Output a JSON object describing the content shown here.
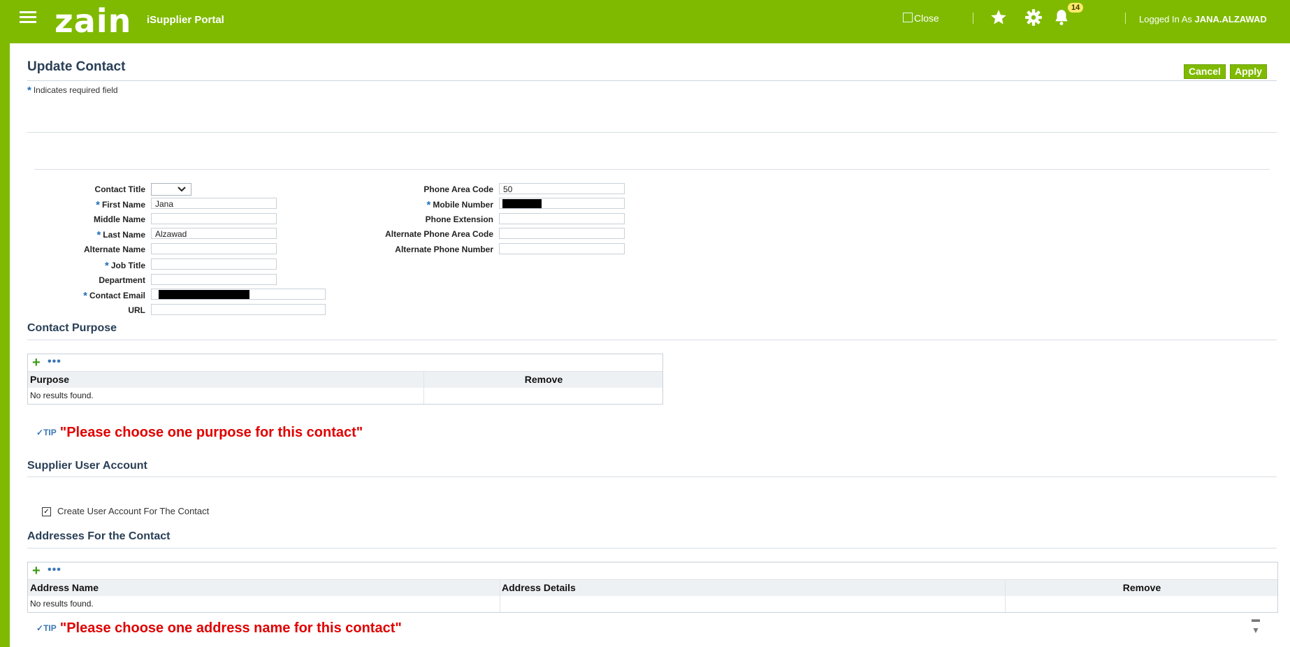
{
  "header": {
    "logo_text": "zain",
    "portal_title": "iSupplier Portal",
    "close_label": "Close",
    "notification_count": "14",
    "logged_in_prefix": "Logged In As",
    "username": "JANA.ALZAWAD",
    "brand_color": "#7fba00",
    "icons": [
      "menu-icon",
      "favorites-star-icon",
      "settings-gear-icon",
      "notifications-bell-icon"
    ]
  },
  "page": {
    "title": "Update Contact",
    "required_star": "*",
    "required_note": "Indicates required field",
    "cancel_label": "Cancel",
    "apply_label": "Apply"
  },
  "form": {
    "left": [
      {
        "label": "Contact Title",
        "value": "",
        "required": false,
        "type": "select"
      },
      {
        "label": "First Name",
        "value": "Jana",
        "required": true
      },
      {
        "label": "Middle Name",
        "value": "",
        "required": false
      },
      {
        "label": "Last Name",
        "value": "Alzawad",
        "required": true
      },
      {
        "label": "Alternate Name",
        "value": "",
        "required": false
      },
      {
        "label": "Job Title",
        "value": "",
        "required": true
      },
      {
        "label": "Department",
        "value": "",
        "required": false
      },
      {
        "label": "Contact Email",
        "value": "",
        "required": true,
        "redacted": true
      },
      {
        "label": "URL",
        "value": "",
        "required": false
      }
    ],
    "right": [
      {
        "label": "Phone Area Code",
        "value": "50",
        "required": false
      },
      {
        "label": "Mobile Number",
        "value": "",
        "required": true,
        "redacted": true
      },
      {
        "label": "Phone Extension",
        "value": "",
        "required": false
      },
      {
        "label": "Alternate Phone Area Code",
        "value": "",
        "required": false
      },
      {
        "label": "Alternate Phone Number",
        "value": "",
        "required": false
      }
    ]
  },
  "contact_purpose": {
    "title": "Contact Purpose",
    "columns": [
      "Purpose",
      "Remove"
    ],
    "empty_text": "No results found.",
    "tip_badge": "TIP",
    "tip_text": "\"Please choose one purpose for this contact\""
  },
  "user_account": {
    "title": "Supplier User Account",
    "checkbox_label": "Create User Account For The Contact",
    "checked": true
  },
  "addresses": {
    "title": "Addresses For the Contact",
    "columns": [
      "Address Name",
      "Address Details",
      "Remove"
    ],
    "empty_text": "No results found.",
    "tip_badge": "TIP",
    "tip_text": "\"Please choose one address name for this contact\""
  }
}
